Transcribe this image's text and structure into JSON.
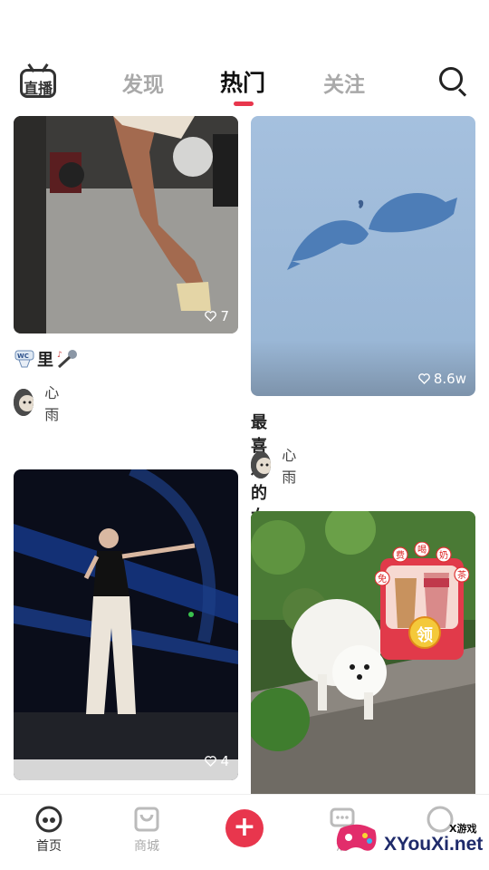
{
  "header": {
    "live_label": "直播",
    "tabs": [
      {
        "label": "发现",
        "active": false
      },
      {
        "label": "热门",
        "active": true
      },
      {
        "label": "关注",
        "active": false
      }
    ]
  },
  "feed": [
    {
      "title": "里",
      "likes": "7",
      "author": "心雨"
    },
    {
      "title": "最喜欢的女主播～",
      "likes": "8.6w",
      "author": "心雨"
    },
    {
      "title": "",
      "likes": "4",
      "author": ""
    },
    {
      "title": "",
      "likes": "",
      "author": ""
    }
  ],
  "promo": {
    "chars": [
      "免",
      "费",
      "喝",
      "奶",
      "茶"
    ],
    "claim_label": "领"
  },
  "bottom_nav": [
    {
      "label": "首页",
      "active": true
    },
    {
      "label": "商城",
      "active": false
    },
    {
      "label": "消",
      "active": false
    }
  ],
  "watermark": {
    "text": "XYouXi.net",
    "small": "X游戏"
  },
  "colors": {
    "accent": "#e8364d",
    "tab_inactive": "#a9a9a9"
  }
}
